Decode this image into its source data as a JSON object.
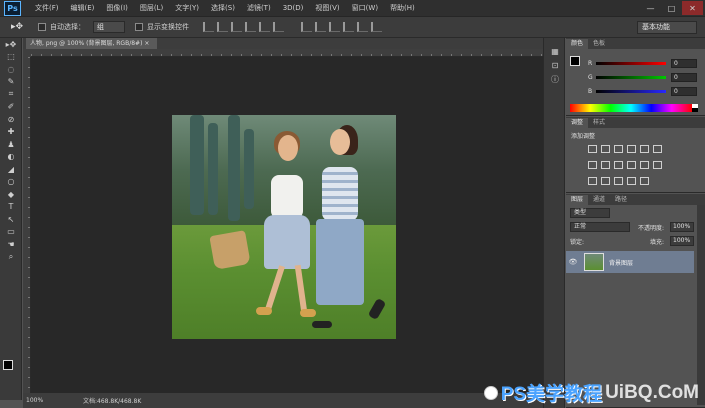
{
  "app": {
    "logo": "Ps"
  },
  "menu": [
    "文件(F)",
    "编辑(E)",
    "图像(I)",
    "图层(L)",
    "文字(Y)",
    "选择(S)",
    "滤镜(T)",
    "3D(D)",
    "视图(V)",
    "窗口(W)",
    "帮助(H)"
  ],
  "window_buttons": {
    "minimize": "—",
    "maximize": "□",
    "close": "✕"
  },
  "options": {
    "auto_select_label": "自动选择：",
    "auto_select_value": "组",
    "show_transform_label": "显示变换控件",
    "workspace": "基本功能"
  },
  "document": {
    "tab_title": "人物, png @ 100% (背景图层, RGB/8#) ×",
    "zoom": "100%",
    "doc_info": "文档:468.8K/468.8K"
  },
  "tools": [
    "▸✥",
    "⬚",
    "◌",
    "✎",
    "⌗",
    "✐",
    "⊘",
    "✚",
    "♟",
    "◐",
    "◢",
    "○",
    "◆",
    "T",
    "↖",
    "▭",
    "☚",
    "⌕"
  ],
  "colors_panel": {
    "tabs": [
      "颜色",
      "色板"
    ],
    "r_label": "R",
    "g_label": "G",
    "b_label": "B",
    "r": "0",
    "g": "0",
    "b": "0"
  },
  "adjustments_panel": {
    "tabs": [
      "调整",
      "样式"
    ],
    "title": "添加调整"
  },
  "layers_panel": {
    "tabs": [
      "图层",
      "通道",
      "路径"
    ],
    "filter": "类型",
    "blend_mode": "正常",
    "opacity_label": "不透明度:",
    "opacity": "100%",
    "lock_label": "锁定:",
    "fill_label": "填充:",
    "fill": "100%",
    "layers": [
      {
        "name": "背景图层"
      }
    ]
  },
  "watermark": {
    "text": "PS美学教程",
    "domain": "UiBQ.CoM"
  }
}
